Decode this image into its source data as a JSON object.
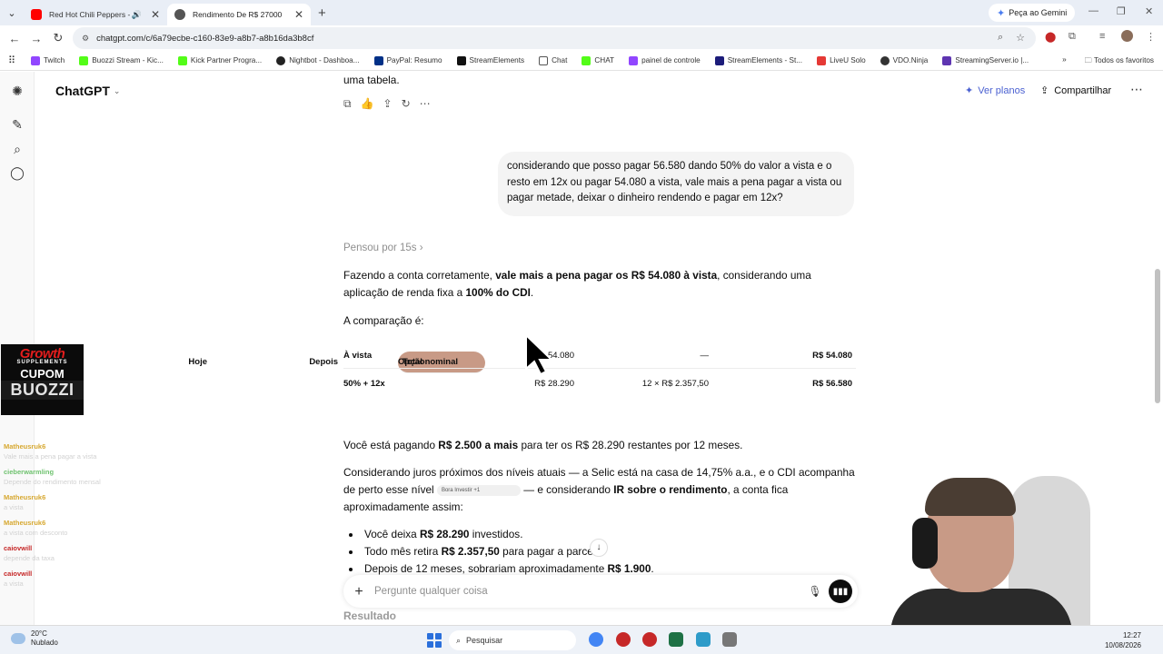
{
  "browser": {
    "tabs": [
      {
        "title": "Red Hot Chili Peppers - Sca",
        "active": false
      },
      {
        "title": "Rendimento De R$ 27000",
        "active": true
      }
    ],
    "gemini_label": "Peça ao Gemini",
    "url": "chatgpt.com/c/6a79ecbe-c160-83e9-a8b7-a8b16da3b8cf",
    "bookmarks": [
      "Twitch",
      "Buozzi Stream - Kic...",
      "Kick Partner Progra...",
      "Nightbot - Dashboa...",
      "PayPal: Resumo",
      "StreamElements",
      "Chat",
      "CHAT",
      "painel de controle",
      "StreamElements - St...",
      "LiveU Solo",
      "VDO.Ninja",
      "StreamingServer.io |..."
    ],
    "bookmarks_folder": "Todos os favoritos"
  },
  "header": {
    "title": "ChatGPT",
    "ver_planos": "Ver planos",
    "compartilhar": "Compartilhar"
  },
  "conversation": {
    "prev_end": "uma tabela.",
    "user_message": "considerando que posso pagar 56.580 dando 50% do valor a vista e o resto em 12x ou pagar 54.080 a vista, vale mais a pena pagar a vista ou pagar metade, deixar o dinheiro rendendo e pagar em 12x?",
    "thought": "Pensou por 15s",
    "p1_a": "Fazendo a conta corretamente, ",
    "p1_b": "vale mais a pena pagar os R$ 54.080 à vista",
    "p1_c": ", considerando uma aplicação de renda fixa a ",
    "p1_d": "100% do CDI",
    "p1_e": ".",
    "p2": "A comparação é:",
    "table": {
      "headers": [
        "Opção",
        "Hoje",
        "Depois",
        "Total nominal"
      ],
      "rows": [
        [
          "À vista",
          "R$ 54.080",
          "—",
          "R$ 54.080"
        ],
        [
          "50% + 12x",
          "R$ 28.290",
          "12 × R$ 2.357,50",
          "R$ 56.580"
        ]
      ]
    },
    "p3_a": "Você está pagando ",
    "p3_b": "R$ 2.500 a mais",
    "p3_c": " para ter os R$ 28.290 restantes por 12 meses.",
    "p4_a": "Considerando juros próximos dos níveis atuais — a Selic está na casa de 14,75% a.a., e o CDI acompanha de perto esse nível ",
    "p4_chip": "Bora Investir +1",
    "p4_b": " — e considerando ",
    "p4_c": "IR sobre o rendimento",
    "p4_d": ", a conta fica aproximadamente assim:",
    "bullets": [
      {
        "a": "Você deixa ",
        "b": "R$ 28.290",
        "c": " investidos."
      },
      {
        "a": "Todo mês retira ",
        "b": "R$ 2.357,50",
        "c": " para pagar a parcela."
      },
      {
        "a": "Depois de 12 meses, sobrariam aproximadamente ",
        "b": "R$ 1.900",
        "c": "."
      }
    ],
    "composer_placeholder": "Pergunte qualquer coisa",
    "next_heading": "Resultado"
  },
  "overlay": {
    "sponsor": {
      "l1": "Growth",
      "l2": "SUPPLEMENTS",
      "l3": "CUPOM",
      "l4": "BUOZZI"
    },
    "chat": [
      {
        "user": "Matheusruk6",
        "msg": "Vale mais a pena pagar a vista"
      },
      {
        "user": "cieberwarmling",
        "msg": "Depende do rendimento mensal"
      },
      {
        "user": "Matheusruk6",
        "msg": "a vista"
      },
      {
        "user": "Matheusruk6",
        "msg": "a vista com desconto"
      },
      {
        "user": "caiovwill",
        "msg": "depende da taxa"
      },
      {
        "user": "caiovwill",
        "msg": "a vista"
      }
    ]
  },
  "taskbar": {
    "temp": "20°C",
    "weather": "Nublado",
    "search": "Pesquisar",
    "time": "12:27",
    "date": "10/08/2026"
  }
}
